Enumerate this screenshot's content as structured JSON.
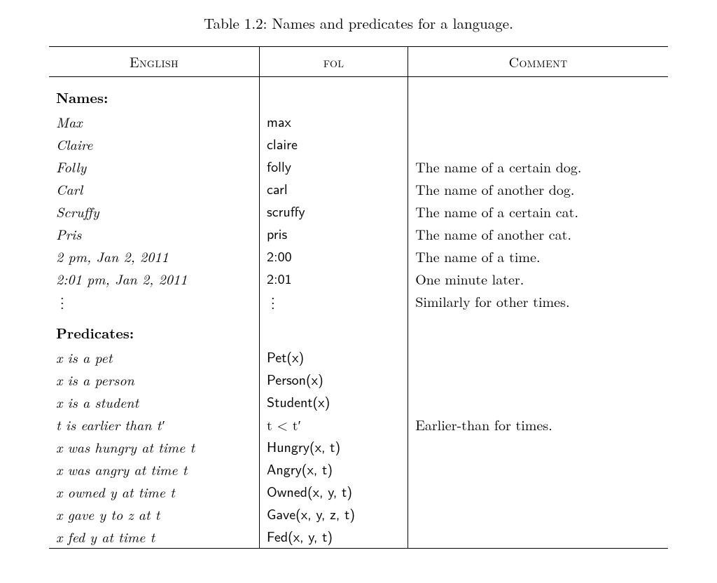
{
  "caption": "Table 1.2: Names and predicates for a language.",
  "headers": {
    "c1": "English",
    "c2": "fol",
    "c3": "Comment"
  },
  "sections": {
    "names_label": "Names:",
    "predicates_label": "Predicates:"
  },
  "names": [
    {
      "english": "Max",
      "fol": "max",
      "comment": ""
    },
    {
      "english": "Claire",
      "fol": "claire",
      "comment": ""
    },
    {
      "english": "Folly",
      "fol": "folly",
      "comment": "The name of a certain dog."
    },
    {
      "english": "Carl",
      "fol": "carl",
      "comment": "The name of another dog."
    },
    {
      "english": "Scruffy",
      "fol": "scruffy",
      "comment": "The name of a certain cat."
    },
    {
      "english": "Pris",
      "fol": "pris",
      "comment": "The name of another cat."
    },
    {
      "english": "2 pm, Jan 2, 2011",
      "fol": "2:00",
      "comment": "The name of a time."
    },
    {
      "english": "2:01 pm, Jan 2, 2011",
      "fol": "2:01",
      "comment": "One minute later."
    }
  ],
  "names_ellipsis_comment": "Similarly for other times.",
  "predicates": [
    {
      "english": "x is a pet",
      "fol": "Pet(x)",
      "comment": ""
    },
    {
      "english": "x is a person",
      "fol": "Person(x)",
      "comment": ""
    },
    {
      "english": "x is a student",
      "fol": "Student(x)",
      "comment": ""
    },
    {
      "english": "t is earlier than t′",
      "fol": "t < t′",
      "comment": "Earlier-than for times."
    },
    {
      "english": "x was hungry at time t",
      "fol": "Hungry(x, t)",
      "comment": ""
    },
    {
      "english": "x was angry at time t",
      "fol": "Angry(x, t)",
      "comment": ""
    },
    {
      "english": "x owned y at time t",
      "fol": "Owned(x, y, t)",
      "comment": ""
    },
    {
      "english": "x gave y to z at t",
      "fol": "Gave(x, y, z, t)",
      "comment": ""
    },
    {
      "english": "x fed y at time t",
      "fol": "Fed(x, y, t)",
      "comment": ""
    }
  ]
}
